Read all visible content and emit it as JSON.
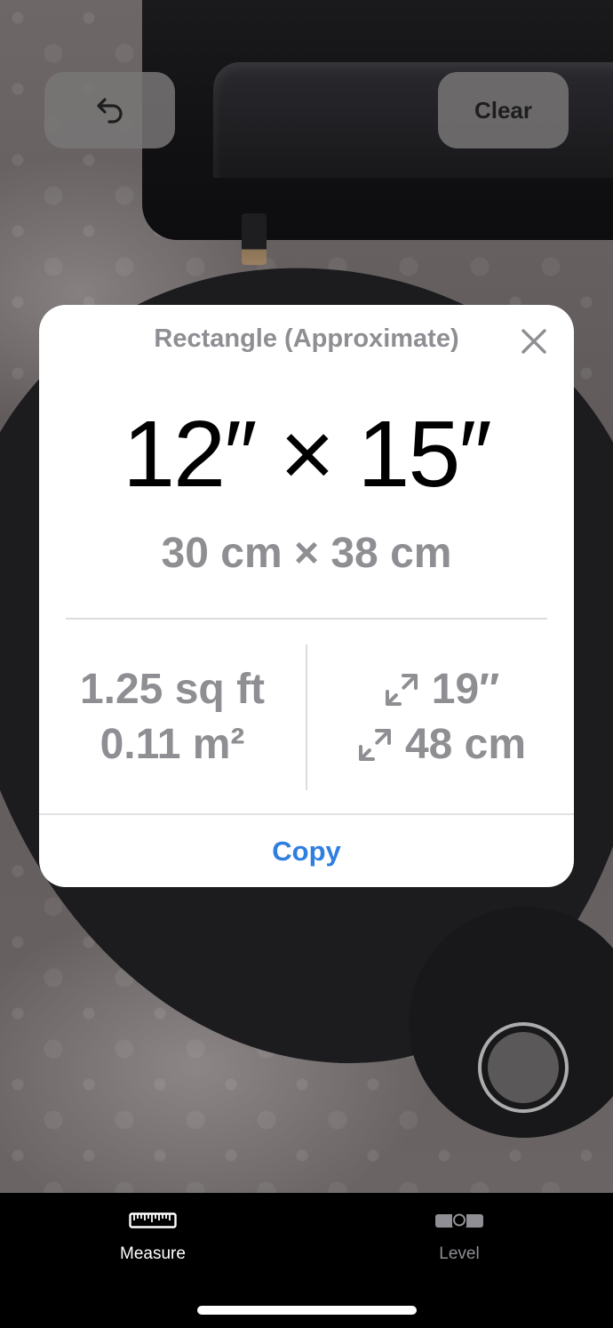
{
  "toolbar": {
    "undo_icon": "undo-arrow-icon",
    "clear_label": "Clear"
  },
  "result_card": {
    "title": "Rectangle (Approximate)",
    "close_icon": "close-icon",
    "dimensions_imperial": "12″ × 15″",
    "dimensions_metric": "30 cm × 38 cm",
    "area_imperial": "1.25 sq ft",
    "area_metric": "0.11 m²",
    "diagonal_imperial": "19″",
    "diagonal_metric": "48 cm",
    "diagonal_icon": "diagonal-arrows-icon",
    "copy_label": "Copy"
  },
  "shutter": {
    "icon": "shutter-icon"
  },
  "tabbar": {
    "tabs": [
      {
        "label": "Measure",
        "icon": "ruler-icon",
        "selected": true
      },
      {
        "label": "Level",
        "icon": "level-icon",
        "selected": false
      }
    ]
  },
  "colors": {
    "accent": "#2f7fe0",
    "secondary_text": "#8e8e93",
    "card_bg": "#ffffff"
  }
}
